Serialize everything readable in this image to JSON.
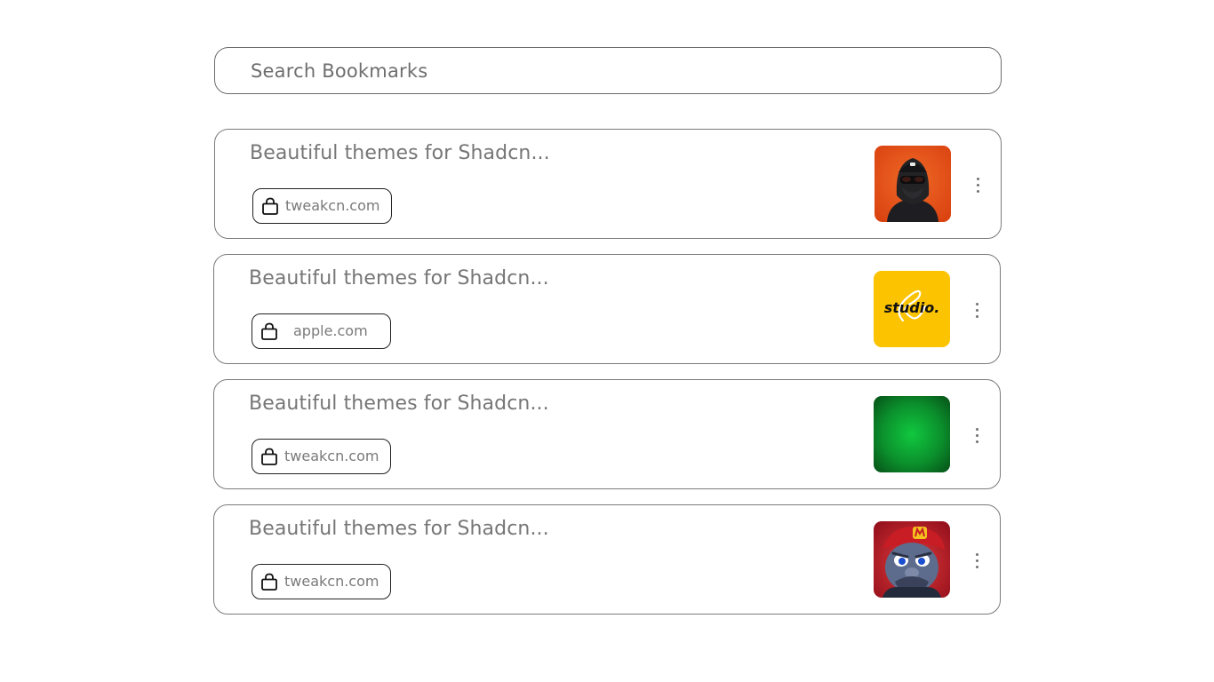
{
  "search": {
    "placeholder": "Search Bookmarks",
    "value": ""
  },
  "bookmarks": [
    {
      "title": "Beautiful themes for Shadcn...",
      "domain": "tweakcn.com",
      "domain_icon": "shopping-bag-icon",
      "thumbnail": "hooded-figure-orange-thumbnail",
      "thumbnail_colors": [
        "#e9541c",
        "#222222"
      ],
      "menu_icon": "more-vertical-icon"
    },
    {
      "title": "Beautiful themes for Shadcn...",
      "domain": "apple.com",
      "domain_icon": "shopping-bag-icon",
      "thumbnail": "studio-logo-thumbnail",
      "thumbnail_text": "studio.",
      "thumbnail_colors": [
        "#fbc300",
        "#111111"
      ],
      "menu_icon": "more-vertical-icon"
    },
    {
      "title": "Beautiful themes for Shadcn...",
      "domain": "tweakcn.com",
      "domain_icon": "shopping-bag-icon",
      "thumbnail": "green-gradient-thumbnail",
      "thumbnail_colors": [
        "#10c83f",
        "#064d16"
      ],
      "menu_icon": "more-vertical-icon"
    },
    {
      "title": "Beautiful themes for Shadcn...",
      "domain": "tweakcn.com",
      "domain_icon": "shopping-bag-icon",
      "thumbnail": "game-character-thumbnail",
      "thumbnail_colors": [
        "#c0182a",
        "#1f5fa8"
      ],
      "menu_icon": "more-vertical-icon"
    }
  ]
}
